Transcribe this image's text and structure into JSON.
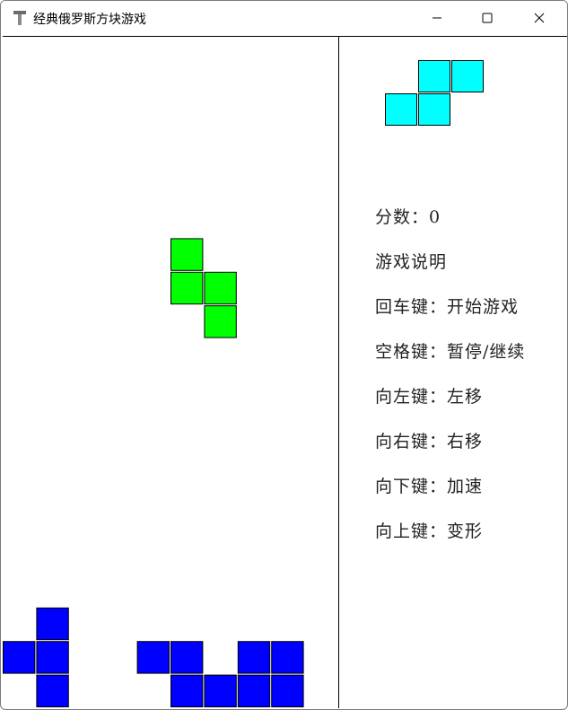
{
  "window": {
    "title": "经典俄罗斯方块游戏",
    "icon": "hammer-icon",
    "controls": [
      "minimize-icon",
      "maximize-icon",
      "close-icon"
    ]
  },
  "colors": {
    "falling_piece": "#00ff00",
    "next_piece": "#00ffff",
    "stacked": "#0000ff",
    "border": "#000000"
  },
  "board": {
    "columns": 10,
    "falling_piece": {
      "shape": "S",
      "cells": [
        [
          5,
          6
        ],
        [
          5,
          7
        ],
        [
          6,
          7
        ],
        [
          6,
          8
        ]
      ]
    },
    "stacked_cells": [
      [
        1,
        17
      ],
      [
        0,
        18
      ],
      [
        1,
        18
      ],
      [
        4,
        18
      ],
      [
        5,
        18
      ],
      [
        7,
        18
      ],
      [
        8,
        18
      ],
      [
        1,
        19
      ],
      [
        5,
        19
      ],
      [
        6,
        19
      ],
      [
        7,
        19
      ],
      [
        8,
        19
      ]
    ]
  },
  "next_piece": {
    "shape": "S",
    "cells": [
      [
        1,
        0
      ],
      [
        2,
        0
      ],
      [
        0,
        1
      ],
      [
        1,
        1
      ]
    ]
  },
  "score": {
    "label": "分数：",
    "value": "0"
  },
  "instructions": {
    "heading": "游戏说明",
    "items": [
      "回车键：开始游戏",
      "空格键：暂停/继续",
      "向左键：左移",
      "向右键：右移",
      "向下键：加速",
      "向上键：变形"
    ]
  }
}
